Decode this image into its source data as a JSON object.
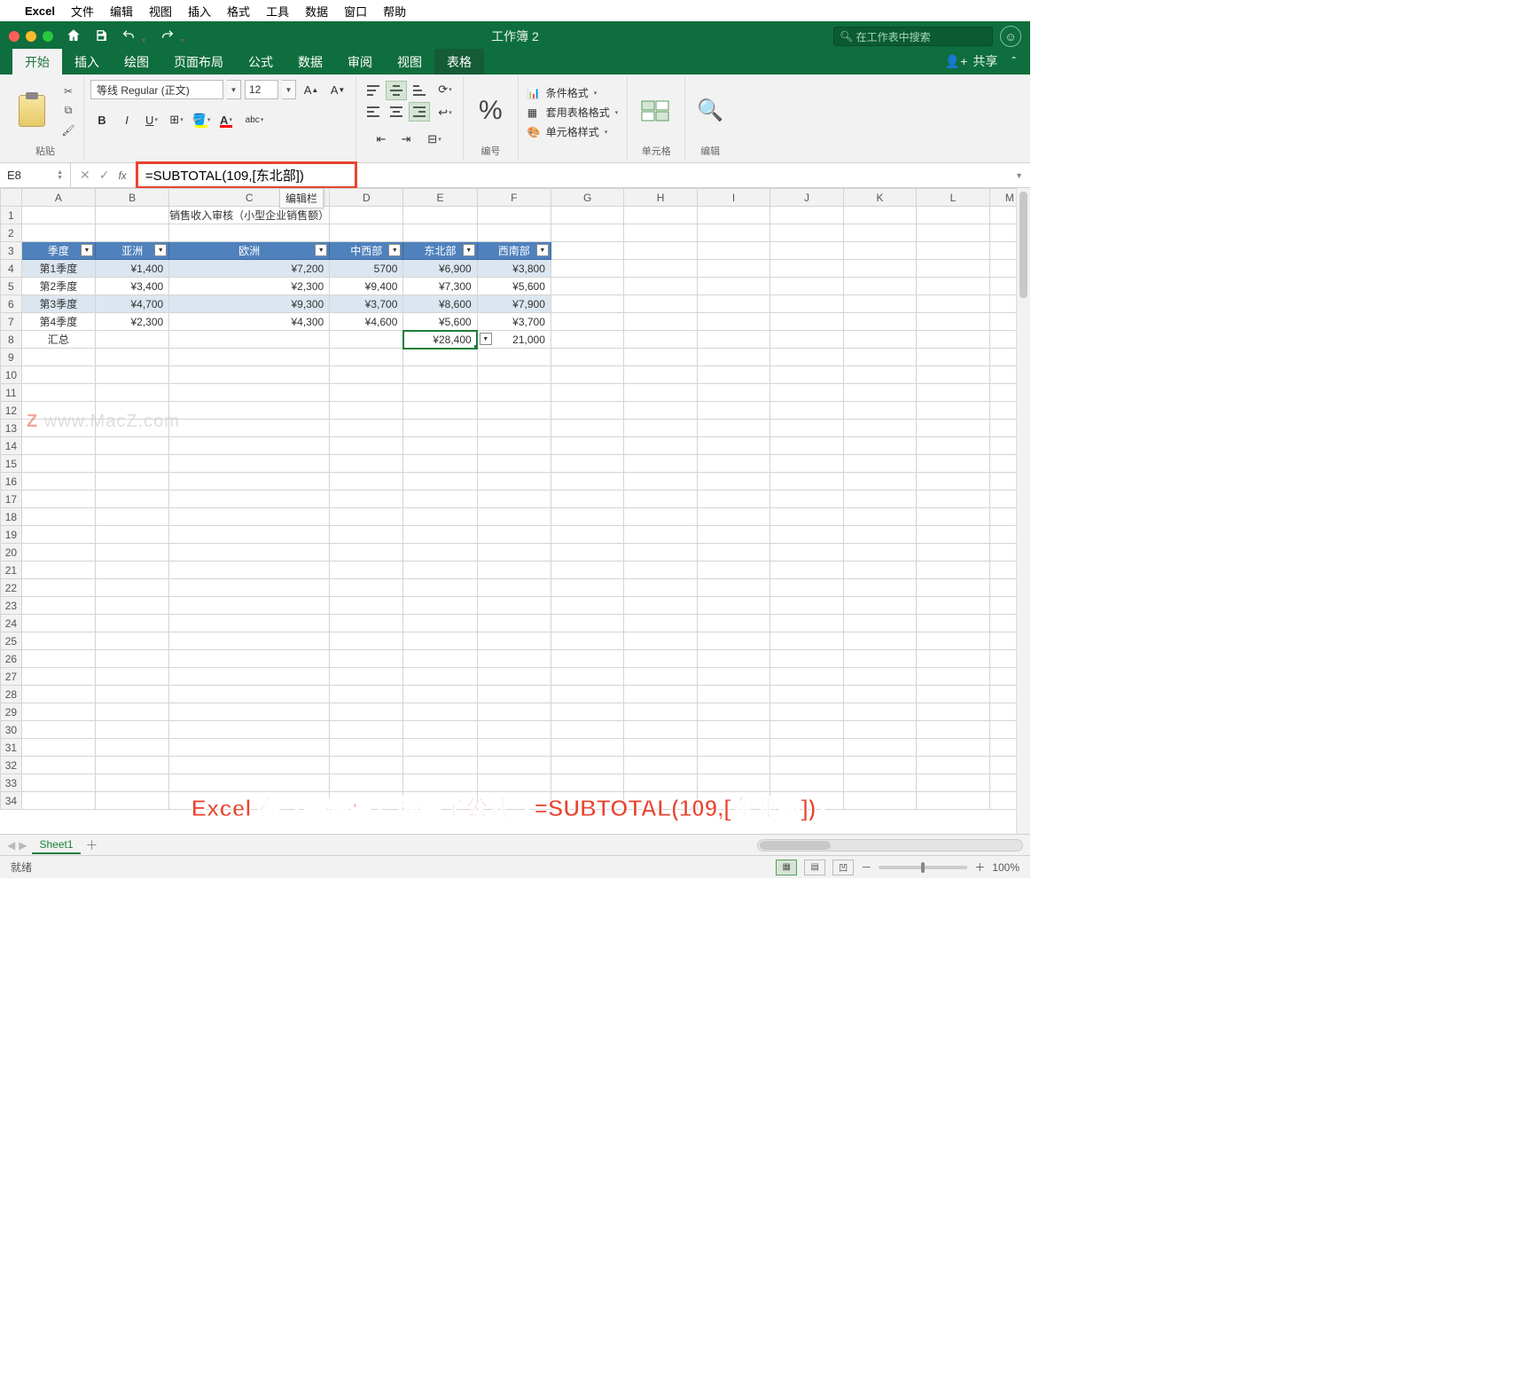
{
  "mac_menu": {
    "app": "Excel",
    "items": [
      "文件",
      "编辑",
      "视图",
      "插入",
      "格式",
      "工具",
      "数据",
      "窗口",
      "帮助"
    ]
  },
  "title_bar": {
    "doc_title": "工作簿 2",
    "search_placeholder": "在工作表中搜索"
  },
  "ribbon_tabs": [
    "开始",
    "插入",
    "绘图",
    "页面布局",
    "公式",
    "数据",
    "审阅",
    "视图",
    "表格"
  ],
  "ribbon": {
    "paste_label": "粘贴",
    "font_name": "等线 Regular (正文)",
    "font_size": "12",
    "number_label": "编号",
    "cells_label": "单元格",
    "edit_label": "编辑",
    "share_label": "共享",
    "styles": {
      "conditional": "条件格式",
      "table": "套用表格格式",
      "cell": "单元格样式"
    }
  },
  "formula_bar": {
    "cell_ref": "E8",
    "formula": "=SUBTOTAL(109,[东北部])",
    "tooltip": "编辑栏"
  },
  "columns": [
    "A",
    "B",
    "C",
    "D",
    "E",
    "F",
    "G",
    "H",
    "I",
    "J",
    "K",
    "L",
    "M"
  ],
  "spreadsheet": {
    "title": "销售收入审核（小型企业销售额）",
    "headers": [
      "季度",
      "亚洲",
      "欧洲",
      "中西部",
      "东北部",
      "西南部"
    ],
    "rows": [
      {
        "q": "第1季度",
        "asia": "¥1,400",
        "eu": "¥7,200",
        "mw": "5700",
        "ne": "¥6,900",
        "sw": "¥3,800"
      },
      {
        "q": "第2季度",
        "asia": "¥3,400",
        "eu": "¥2,300",
        "mw": "¥9,400",
        "ne": "¥7,300",
        "sw": "¥5,600"
      },
      {
        "q": "第3季度",
        "asia": "¥4,700",
        "eu": "¥9,300",
        "mw": "¥3,700",
        "ne": "¥8,600",
        "sw": "¥7,900"
      },
      {
        "q": "第4季度",
        "asia": "¥2,300",
        "eu": "¥4,300",
        "mw": "¥4,600",
        "ne": "¥5,600",
        "sw": "¥3,700"
      }
    ],
    "total": {
      "label": "汇总",
      "ne": "¥28,400",
      "sw": "21,000"
    }
  },
  "row_count": 34,
  "sheet_tabs": {
    "active": "Sheet1"
  },
  "status_bar": {
    "status": "就绪",
    "zoom": "100%",
    "minus": "－",
    "plus": "＋"
  },
  "annotation": "Excel 在「编辑栏」创建了公式「=SUBTOTAL(109,[东北部])」",
  "watermark": {
    "z": "Z",
    "rest": "  www.MacZ.com"
  }
}
